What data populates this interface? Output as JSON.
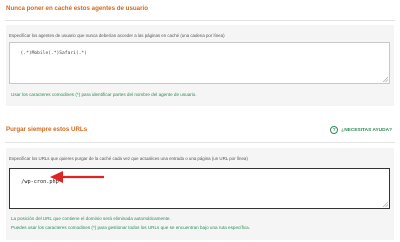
{
  "user_agents": {
    "title": "Nunca poner en caché estos agentes de usuario",
    "description": "Especificar los agentes de usuario que nunca deberían acceder a las páginas en caché (una cadena por línea)",
    "value": "(.*)Mobile(.*)Safari(.*)",
    "help": "Usar los caracteres comodines (*) para identificar partes del nombre del agente de usuario."
  },
  "purge_urls": {
    "title": "Purgar siempre estos URLs",
    "help_link": "¿NECESITAS AYUDA?",
    "description": "Especificar los URLs que quieres purgar de la caché cada vez que actualices una entrada o una página (un URL por línea)",
    "value": "/wp-cron.php",
    "help_line1": "La posición del URL que contiene el dominio será eliminada automáticamente.",
    "help_line2": "Puedes usar los caracteres comodines (*) para gestionar todos los URLs que se encuentran bajo una ruta específica."
  },
  "colors": {
    "heading": "#d2691e",
    "help": "#2e8b57",
    "arrow": "#e02424"
  }
}
